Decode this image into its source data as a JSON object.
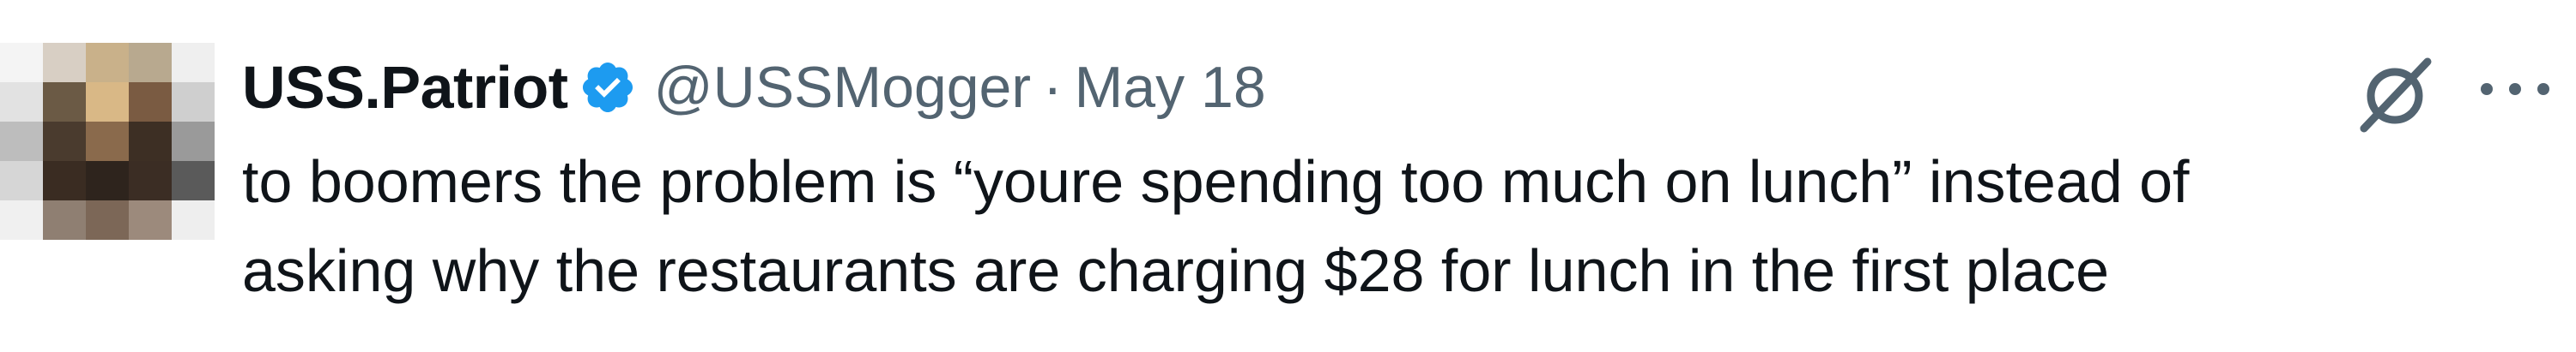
{
  "tweet": {
    "display_name": "USS.Patriot",
    "handle": "@USSMogger",
    "separator": "·",
    "date": "May 18",
    "verified": true,
    "text_lines": [
      "to boomers the problem is “youre spending too much on lunch” instead of",
      "asking why the restaurants are charging $28 for lunch in the first place"
    ]
  },
  "icons": {
    "verified": "verified-badge-icon",
    "grok": "grok-icon",
    "more": "more-options-icon"
  },
  "colors": {
    "verified_blue": "#1d9bf0",
    "secondary_text": "#536471",
    "primary_text": "#0f1419"
  }
}
